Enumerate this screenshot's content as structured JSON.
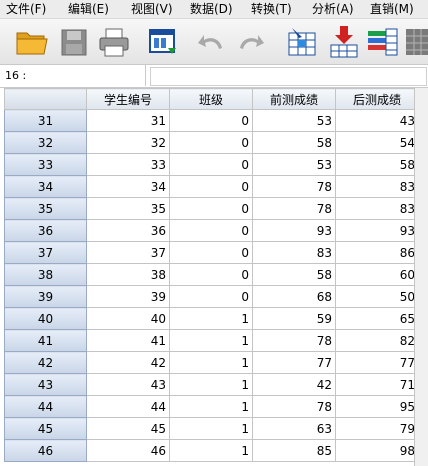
{
  "menu": [
    {
      "id": "file",
      "label": "文件(F)"
    },
    {
      "id": "edit",
      "label": "编辑(E)"
    },
    {
      "id": "view",
      "label": "视图(V)"
    },
    {
      "id": "data",
      "label": "数据(D)"
    },
    {
      "id": "transform",
      "label": "转换(T)"
    },
    {
      "id": "analyze",
      "label": "分析(A)"
    },
    {
      "id": "direct",
      "label": "直销(M)"
    }
  ],
  "toolbar": {
    "icons": [
      "open-folder-icon",
      "save-icon",
      "print-icon",
      "recall-dialog-icon",
      "undo-icon",
      "redo-icon",
      "goto-case-icon",
      "insert-cases-icon",
      "variables-icon",
      "grid-icon"
    ]
  },
  "cell_ref": {
    "label": "16 :",
    "value": ""
  },
  "grid": {
    "columns": [
      "学生编号",
      "班级",
      "前测成绩",
      "后测成绩"
    ],
    "rows": [
      {
        "num": "31",
        "cells": [
          "31",
          "0",
          "53",
          "43"
        ]
      },
      {
        "num": "32",
        "cells": [
          "32",
          "0",
          "58",
          "54"
        ]
      },
      {
        "num": "33",
        "cells": [
          "33",
          "0",
          "53",
          "58"
        ]
      },
      {
        "num": "34",
        "cells": [
          "34",
          "0",
          "78",
          "83"
        ]
      },
      {
        "num": "35",
        "cells": [
          "35",
          "0",
          "78",
          "83"
        ]
      },
      {
        "num": "36",
        "cells": [
          "36",
          "0",
          "93",
          "93"
        ]
      },
      {
        "num": "37",
        "cells": [
          "37",
          "0",
          "83",
          "86"
        ]
      },
      {
        "num": "38",
        "cells": [
          "38",
          "0",
          "58",
          "60"
        ]
      },
      {
        "num": "39",
        "cells": [
          "39",
          "0",
          "68",
          "50"
        ]
      },
      {
        "num": "40",
        "cells": [
          "40",
          "1",
          "59",
          "65"
        ]
      },
      {
        "num": "41",
        "cells": [
          "41",
          "1",
          "78",
          "82"
        ]
      },
      {
        "num": "42",
        "cells": [
          "42",
          "1",
          "77",
          "77"
        ]
      },
      {
        "num": "43",
        "cells": [
          "43",
          "1",
          "42",
          "71"
        ]
      },
      {
        "num": "44",
        "cells": [
          "44",
          "1",
          "78",
          "95"
        ]
      },
      {
        "num": "45",
        "cells": [
          "45",
          "1",
          "63",
          "79"
        ]
      },
      {
        "num": "46",
        "cells": [
          "46",
          "1",
          "85",
          "98"
        ]
      }
    ]
  }
}
